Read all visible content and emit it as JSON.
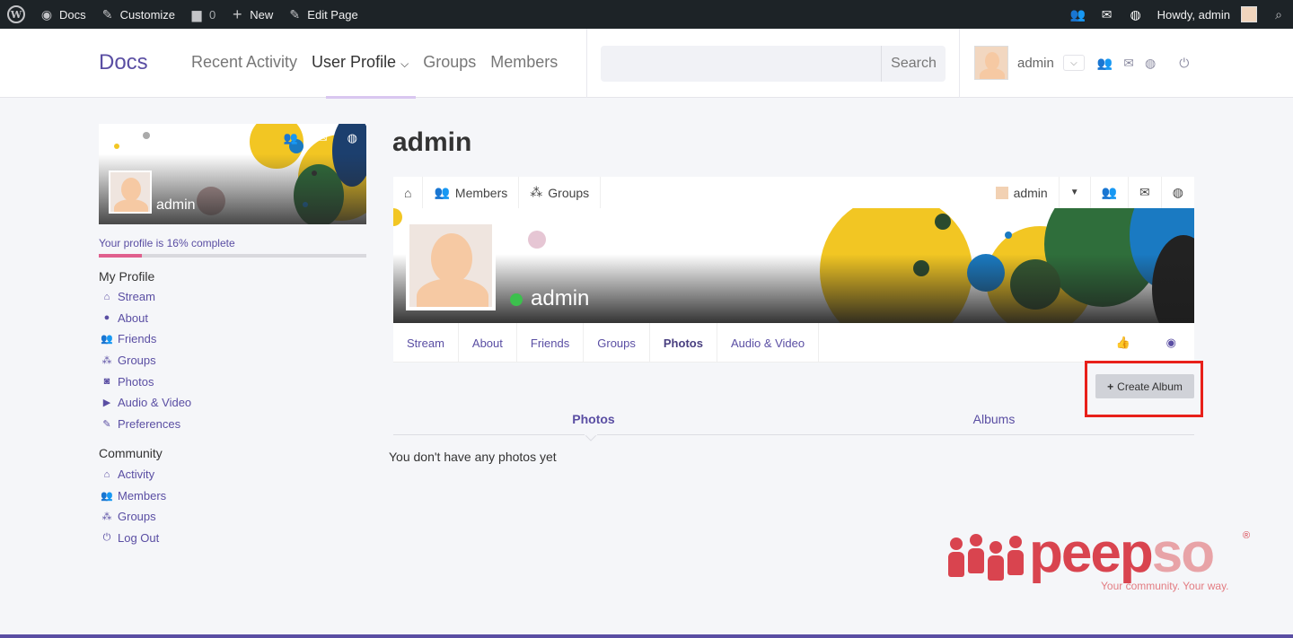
{
  "adminbar": {
    "site": "Docs",
    "customize": "Customize",
    "comments_count": "0",
    "new": "New",
    "edit_page": "Edit Page",
    "howdy": "Howdy, admin"
  },
  "header": {
    "brand": "Docs",
    "nav": [
      "Recent Activity",
      "User Profile",
      "Groups",
      "Members"
    ],
    "search_placeholder": "",
    "search_button": "Search",
    "user": "admin"
  },
  "sidebar": {
    "cover_name": "admin",
    "progress_label": "Your profile is 16% complete",
    "progress_percent": 16,
    "my_profile_title": "My Profile",
    "my_profile": [
      {
        "label": "Stream",
        "icon": "home-icon"
      },
      {
        "label": "About",
        "icon": "user-icon"
      },
      {
        "label": "Friends",
        "icon": "friends-icon"
      },
      {
        "label": "Groups",
        "icon": "groups-icon"
      },
      {
        "label": "Photos",
        "icon": "camera-icon"
      },
      {
        "label": "Audio & Video",
        "icon": "video-icon"
      },
      {
        "label": "Preferences",
        "icon": "edit-icon"
      }
    ],
    "community_title": "Community",
    "community": [
      {
        "label": "Activity",
        "icon": "home-icon"
      },
      {
        "label": "Members",
        "icon": "members-icon"
      },
      {
        "label": "Groups",
        "icon": "groups-icon"
      },
      {
        "label": "Log Out",
        "icon": "power-icon"
      }
    ]
  },
  "main": {
    "title": "admin",
    "focus_bar": {
      "members": "Members",
      "groups": "Groups",
      "user": "admin"
    },
    "cover_name": "admin",
    "tabs": [
      "Stream",
      "About",
      "Friends",
      "Groups",
      "Photos",
      "Audio & Video"
    ],
    "active_tab": "Photos",
    "create_album": "Create Album",
    "sub_tabs": [
      "Photos",
      "Albums"
    ],
    "empty_message": "You don't have any photos yet"
  },
  "logo": {
    "word_a": "peep",
    "word_b": "so",
    "tagline": "Your community. Your way.",
    "reg": "®"
  },
  "colors": {
    "accent": "#5a4ea3",
    "progress": "#e0608e",
    "highlight": "#e8201a",
    "online": "#3cc04d",
    "logo": "#d9444f"
  }
}
